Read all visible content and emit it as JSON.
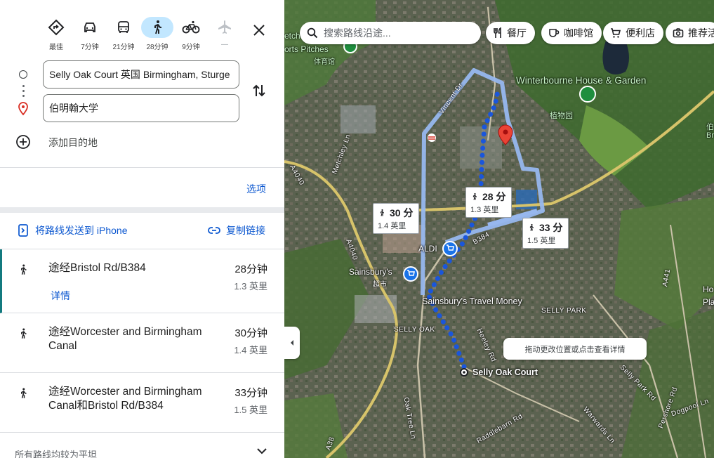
{
  "travel_modes": [
    {
      "name": "best",
      "label": "最佳"
    },
    {
      "name": "drive",
      "label": "7分钟"
    },
    {
      "name": "transit",
      "label": "21分钟"
    },
    {
      "name": "walk",
      "label": "28分钟",
      "active": true
    },
    {
      "name": "bike",
      "label": "9分钟"
    },
    {
      "name": "flight",
      "label": "—",
      "disabled": true
    }
  ],
  "directions": {
    "origin": "Selly Oak Court 英国 Birmingham, Sturge",
    "destination": "伯明翰大学",
    "add_destination": "添加目的地",
    "options": "选项"
  },
  "actions": {
    "send_to_phone": "将路线发送到 iPhone",
    "copy_link": "复制链接"
  },
  "routes": [
    {
      "name": "途经Bristol Rd/B384",
      "time": "28分钟",
      "distance": "1.3 英里",
      "details": "详情"
    },
    {
      "name": "途经Worcester and Birmingham Canal",
      "time": "30分钟",
      "distance": "1.4 英里"
    },
    {
      "name": "途经Worcester and Birmingham Canal和Bristol Rd/B384",
      "time": "33分钟",
      "distance": "1.5 英里"
    }
  ],
  "footer_note": "所有路线均较为平坦",
  "map": {
    "search_placeholder": "搜索路线沿途...",
    "chips": [
      "餐厅",
      "咖啡馆",
      "便利店",
      "推荐活"
    ],
    "callouts": [
      {
        "time": "28 分",
        "distance": "1.3 英里"
      },
      {
        "time": "30 分",
        "distance": "1.4 英里"
      },
      {
        "time": "33 分",
        "distance": "1.5 英里"
      }
    ],
    "labels": {
      "winterbourne": "Winterbourne House & Garden",
      "winterbourne_cn": "植物园",
      "aldi": "ALDI",
      "sainsburys": "Sainsbury's",
      "sainsburys_cn": "超市",
      "travel_money": "Sainsbury's Travel Money",
      "origin": "Selly Oak Court",
      "selly_oak": "SELLY OAK",
      "selly_park": "SELLY PARK",
      "pitches": "orts Pitches",
      "pitches_prefix": "etch",
      "pitches_cn": "体育馆",
      "b384": "B384",
      "a4040_top": "A4040",
      "a4040_mid": "A4040",
      "a38": "A38",
      "a441": "A441",
      "metchley": "Metchley Ln",
      "vincent": "Vincent Dr",
      "heeley": "Heeley Rd",
      "oak_tree": "Oak Tree Ln",
      "raddlebarn": "Raddlebarn Rd",
      "warwards": "Warwards Ln",
      "selly_park_rd": "Selly Park Rd",
      "pershore": "Pershore Rd",
      "dogpool": "Dogpool Ln",
      "edge_ho": "Ho",
      "edge_pla": "Pla",
      "edge_bo": "伯",
      "edge_br": "Br"
    },
    "drag_hint": "拖动更改位置或点击查看详情"
  }
}
